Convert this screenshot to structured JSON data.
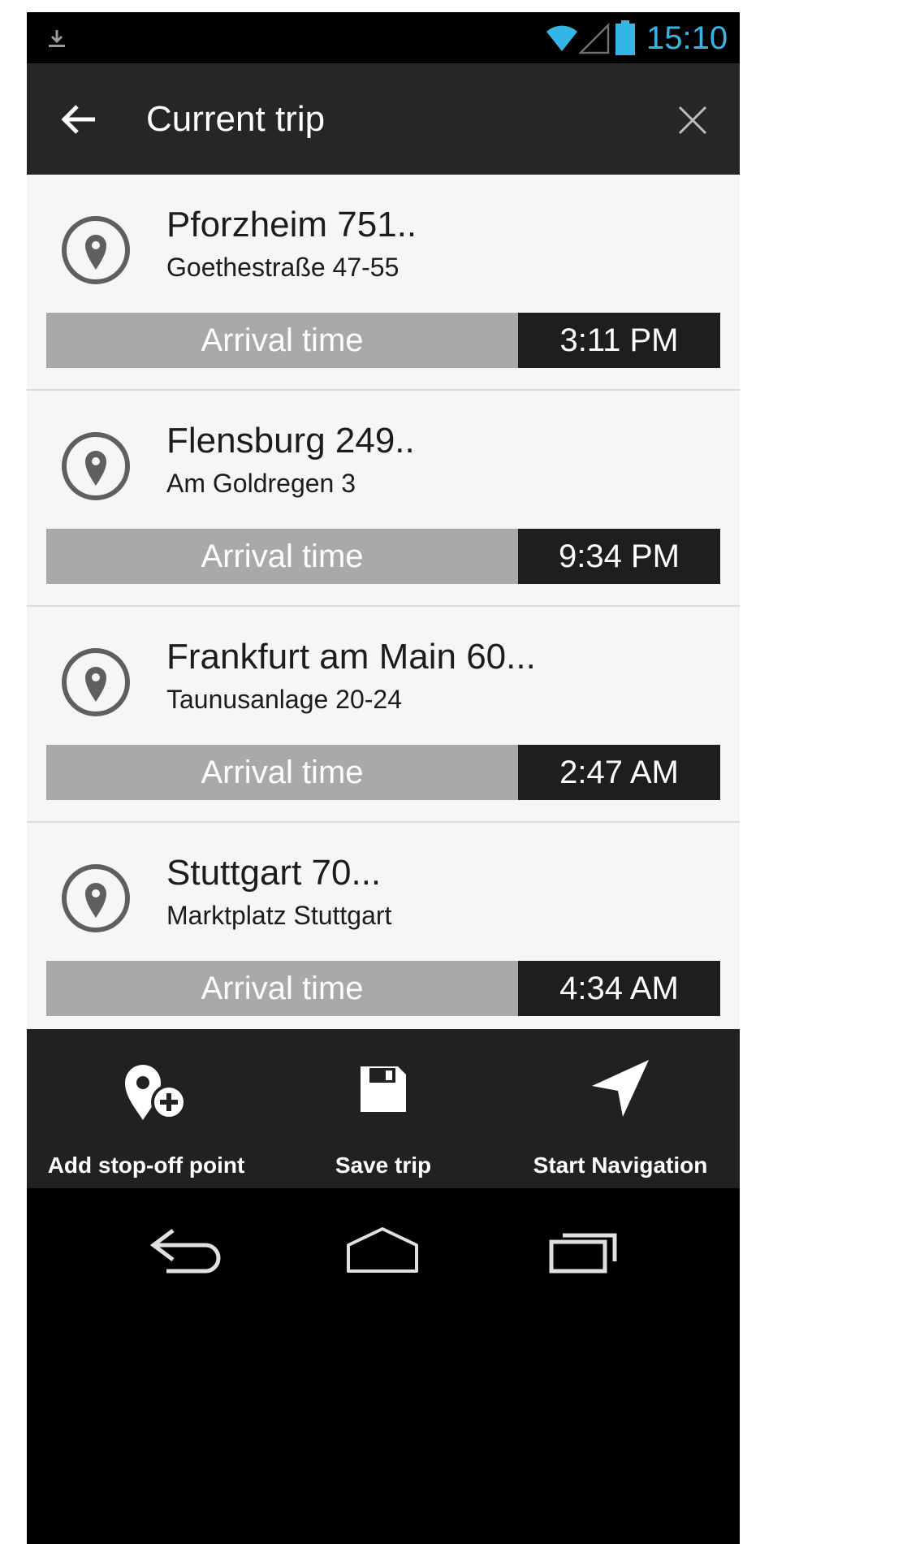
{
  "status_bar": {
    "time": "15:10",
    "download_icon": "download-icon",
    "wifi_icon": "wifi-icon",
    "signal_icon": "signal-icon",
    "battery_icon": "battery-icon",
    "time_color": "#33b5e5"
  },
  "app_bar": {
    "title": "Current trip",
    "back_icon": "arrow-left-icon",
    "close_icon": "close-icon"
  },
  "trip": {
    "stops": [
      {
        "city": "Pforzheim 751..",
        "street": "Goethestraße 47-55",
        "arrival_label": "Arrival time",
        "arrival_time": "3:11 PM"
      },
      {
        "city": "Flensburg 249..",
        "street": "Am Goldregen 3",
        "arrival_label": "Arrival time",
        "arrival_time": "9:34 PM"
      },
      {
        "city": "Frankfurt am Main 60...",
        "street": "Taunusanlage 20-24",
        "arrival_label": "Arrival time",
        "arrival_time": "2:47 AM"
      },
      {
        "city": "Stuttgart 70...",
        "street": "Marktplatz Stuttgart",
        "arrival_label": "Arrival time",
        "arrival_time": "4:34 AM"
      }
    ]
  },
  "actions": {
    "add_stop": {
      "label": "Add stop-off point",
      "icon": "pin-plus-icon"
    },
    "save_trip": {
      "label": "Save trip",
      "icon": "floppy-disk-icon"
    },
    "start_navigation": {
      "label": "Start Navigation",
      "icon": "navigation-arrow-icon"
    }
  },
  "nav_bar": {
    "back_icon": "nav-back-icon",
    "home_icon": "nav-home-icon",
    "recents_icon": "nav-recents-icon"
  },
  "colors": {
    "app_bar": "#262626",
    "list_background": "#f6f6f6",
    "arrival_label_bg": "#a9a9a9",
    "arrival_time_bg": "#1e1e1e",
    "action_bar": "#212121"
  }
}
